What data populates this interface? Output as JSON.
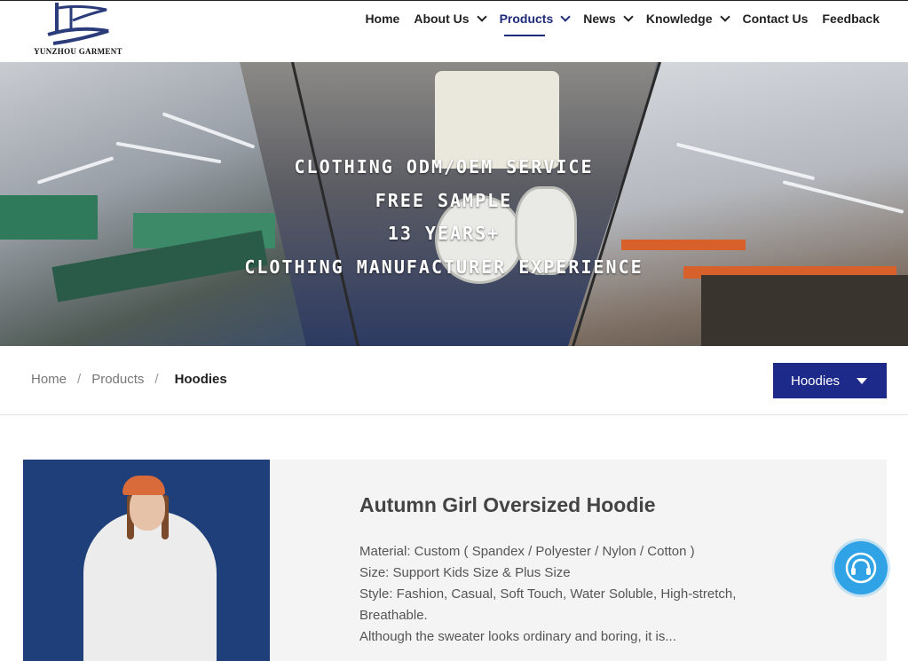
{
  "header": {
    "logo_text": "YUNZHOU GARMENT",
    "nav": [
      {
        "label": "Home",
        "has_dropdown": false,
        "active": false
      },
      {
        "label": "About Us",
        "has_dropdown": true,
        "active": false
      },
      {
        "label": "Products",
        "has_dropdown": true,
        "active": true
      },
      {
        "label": "News",
        "has_dropdown": true,
        "active": false
      },
      {
        "label": "Knowledge",
        "has_dropdown": true,
        "active": false
      },
      {
        "label": "Contact Us",
        "has_dropdown": false,
        "active": false
      },
      {
        "label": "Feedback",
        "has_dropdown": false,
        "active": false
      }
    ]
  },
  "banner": {
    "lines": [
      "Clothing ODM/OEM Service",
      "Free Sample",
      "13 Years+",
      "Clothing Manufacturer Experience"
    ]
  },
  "breadcrumb": {
    "items": [
      "Home",
      "Products"
    ],
    "separator": "/",
    "current": "Hoodies"
  },
  "category_select": {
    "selected": "Hoodies"
  },
  "product": {
    "title": "Autumn Girl Oversized Hoodie",
    "description": [
      "Material: Custom ( Spandex / Polyester / Nylon / Cotton )",
      "Size: Support Kids Size & Plus Size",
      "Style: Fashion, Casual, Soft Touch, Water Soluble, High-stretch, Breathable.",
      "Although the sweater looks ordinary and boring, it is..."
    ]
  },
  "colors": {
    "accent": "#1e2a8a",
    "chat": "#2fa3e6"
  },
  "icons": {
    "chat": "headset-icon",
    "dropdown": "chevron-down-icon"
  }
}
